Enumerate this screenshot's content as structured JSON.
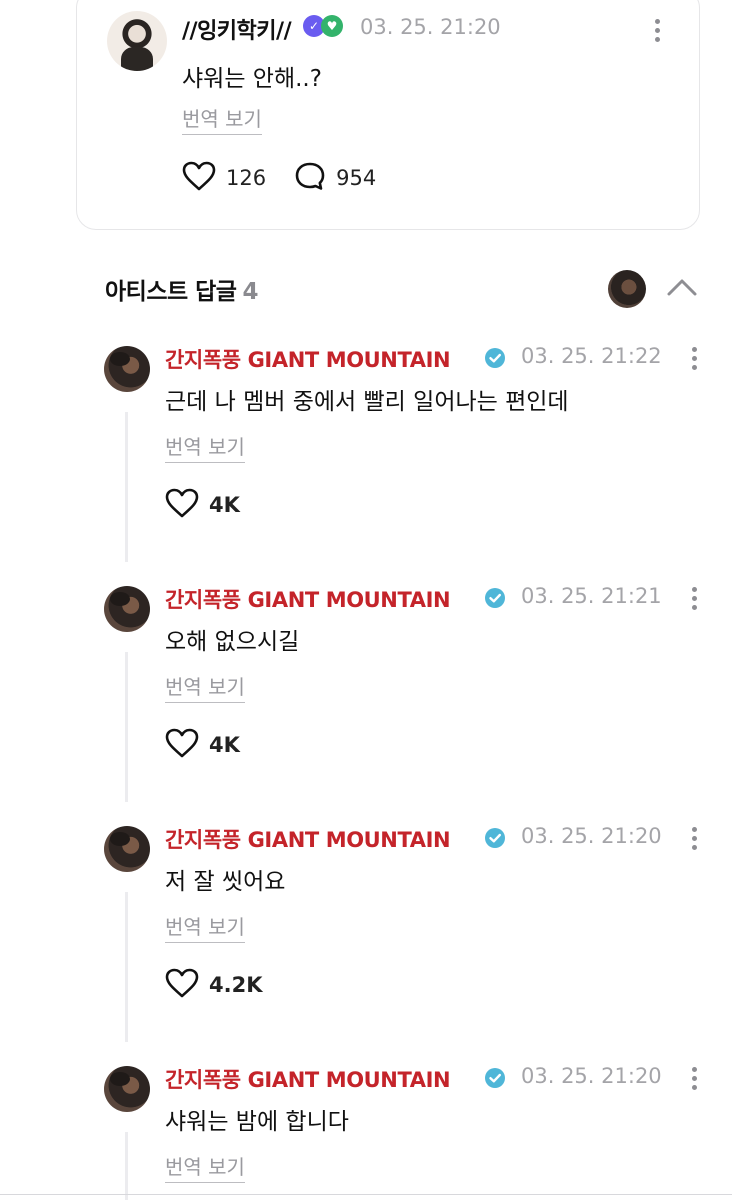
{
  "post": {
    "author": "//잉키학키//",
    "time": "03. 25. 21:20",
    "text": "샤워는 안해..?",
    "translate_label": "번역 보기",
    "likes": "126",
    "comments": "954"
  },
  "artist_replies": {
    "title": "아티스트 답글",
    "count": "4"
  },
  "replies": [
    {
      "author": "간지폭풍 GIANT MOUNTAIN",
      "time": "03. 25. 21:22",
      "text": "근데 나 멤버 중에서 빨리 일어나는 편인데",
      "translate_label": "번역 보기",
      "likes": "4K"
    },
    {
      "author": "간지폭풍 GIANT MOUNTAIN",
      "time": "03. 25. 21:21",
      "text": "오해 없으시길",
      "translate_label": "번역 보기",
      "likes": "4K"
    },
    {
      "author": "간지폭풍 GIANT MOUNTAIN",
      "time": "03. 25. 21:20",
      "text": "저 잘 씻어요",
      "translate_label": "번역 보기",
      "likes": "4.2K"
    },
    {
      "author": "간지폭풍 GIANT MOUNTAIN",
      "time": "03. 25. 21:20",
      "text": "샤워는 밤에 합니다",
      "translate_label": "번역 보기",
      "likes": ""
    }
  ],
  "colors": {
    "artist_name": "#c4242a",
    "verified": "#4fb6d8",
    "muted": "#a4a4a8"
  }
}
